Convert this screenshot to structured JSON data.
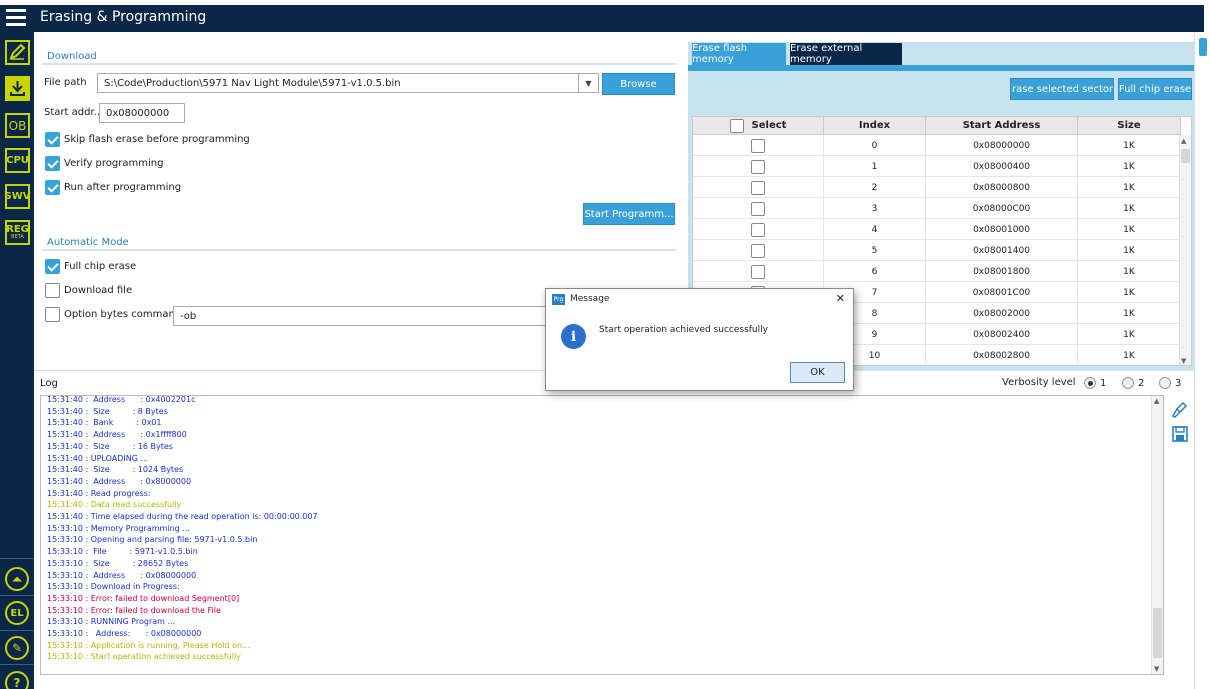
{
  "app": {
    "title": "Erasing & Programming"
  },
  "sidebar": {
    "icons": [
      "edit-icon",
      "download-icon",
      "OB",
      "CPU",
      "SWV",
      "REG",
      "beta-icon",
      "el-icon",
      "erase-icon",
      "help-icon"
    ],
    "reg_sub": "BETA"
  },
  "download": {
    "section_title": "Download",
    "file_path_label": "File path",
    "file_path_value": "S:\\Code\\Production\\5971 Nav Light Module\\5971-v1.0.5.bin",
    "browse_label": "Browse",
    "start_addr_label": "Start addr...",
    "start_addr_value": "0x08000000",
    "skip_erase_label": "Skip flash erase before programming",
    "verify_label": "Verify programming",
    "run_after_label": "Run after programming",
    "start_button_label": "Start Programm..."
  },
  "automatic": {
    "section_title": "Automatic Mode",
    "full_chip_erase_label": "Full chip erase",
    "download_file_label": "Download file",
    "option_bytes_label": "Option bytes commands",
    "option_bytes_value": "-ob"
  },
  "erase": {
    "tabs": [
      "Erase flash memory",
      "Erase external memory"
    ],
    "erase_selected_label": "Erase selected sectors",
    "full_chip_erase_label": "Full chip erase",
    "columns": [
      "Select",
      "Index",
      "Start Address",
      "Size"
    ],
    "rows": [
      {
        "index": "0",
        "address": "0x08000000",
        "size": "1K"
      },
      {
        "index": "1",
        "address": "0x08000400",
        "size": "1K"
      },
      {
        "index": "2",
        "address": "0x08000800",
        "size": "1K"
      },
      {
        "index": "3",
        "address": "0x08000C00",
        "size": "1K"
      },
      {
        "index": "4",
        "address": "0x08001000",
        "size": "1K"
      },
      {
        "index": "5",
        "address": "0x08001400",
        "size": "1K"
      },
      {
        "index": "6",
        "address": "0x08001800",
        "size": "1K"
      },
      {
        "index": "7",
        "address": "0x08001C00",
        "size": "1K"
      },
      {
        "index": "8",
        "address": "0x08002000",
        "size": "1K"
      },
      {
        "index": "9",
        "address": "0x08002400",
        "size": "1K"
      },
      {
        "index": "10",
        "address": "0x08002800",
        "size": "1K"
      }
    ]
  },
  "log": {
    "title": "Log",
    "verbosity_label": "Verbosity level",
    "levels": [
      "1",
      "2",
      "3"
    ],
    "selected_level": "1",
    "colors": {
      "info": "#1a2fd6",
      "success": "#b4b800",
      "error": "#c8003c"
    },
    "lines": [
      {
        "text": "15:31:40 :  Address      : 0x4002201c",
        "type": "info"
      },
      {
        "text": "15:31:40 :  Size         : 8 Bytes",
        "type": "info"
      },
      {
        "text": "15:31:40 :  Bank         : 0x01",
        "type": "info"
      },
      {
        "text": "15:31:40 :  Address      : 0x1ffff800",
        "type": "info"
      },
      {
        "text": "15:31:40 :  Size         : 16 Bytes",
        "type": "info"
      },
      {
        "text": "15:31:40 : UPLOADING ...",
        "type": "info"
      },
      {
        "text": "15:31:40 :  Size         : 1024 Bytes",
        "type": "info"
      },
      {
        "text": "15:31:40 :  Address      : 0x8000000",
        "type": "info"
      },
      {
        "text": "15:31:40 : Read progress:",
        "type": "info"
      },
      {
        "text": "15:31:40 : Data read successfully",
        "type": "success"
      },
      {
        "text": "15:31:40 : Time elapsed during the read operation is: 00:00:00.007",
        "type": "info"
      },
      {
        "text": "15:33:10 : Memory Programming ...",
        "type": "info"
      },
      {
        "text": "15:33:10 : Opening and parsing file: 5971-v1.0.5.bin",
        "type": "info"
      },
      {
        "text": "15:33:10 :  File         : 5971-v1.0.5.bin",
        "type": "info"
      },
      {
        "text": "15:33:10 :  Size         : 28652 Bytes",
        "type": "info"
      },
      {
        "text": "15:33:10 :  Address      : 0x08000000",
        "type": "info"
      },
      {
        "text": "15:33:10 : Download in Progress:",
        "type": "info"
      },
      {
        "text": "15:33:10 : Error: failed to download Segment[0]",
        "type": "error"
      },
      {
        "text": "15:33:10 : Error: failed to download the File",
        "type": "error"
      },
      {
        "text": "15:33:10 : RUNNING Program ...",
        "type": "info"
      },
      {
        "text": "15:33:10 :   Address:      : 0x08000000",
        "type": "info"
      },
      {
        "text": "15:33:10 : Application is running, Please Hold on...",
        "type": "success"
      },
      {
        "text": "15:33:10 : Start operation achieved successfully",
        "type": "success"
      }
    ]
  },
  "dialog": {
    "icon_label": "Prg",
    "title": "Message",
    "close": "✕",
    "message": "Start operation achieved successfully",
    "ok_label": "OK"
  }
}
